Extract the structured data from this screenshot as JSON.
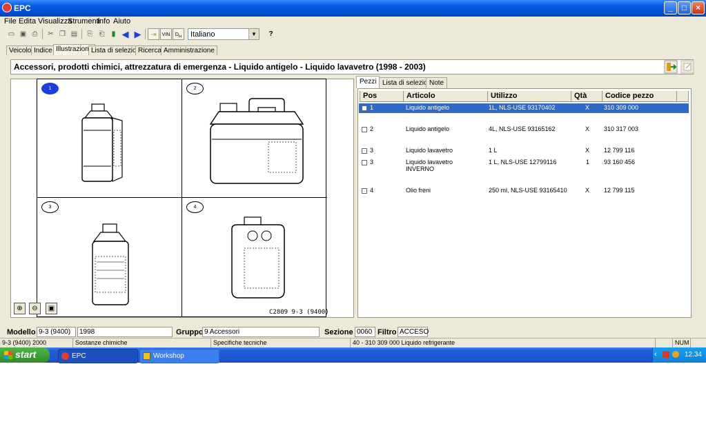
{
  "window": {
    "title": "EPC",
    "buttons": {
      "minimize": "_",
      "maximize": "□",
      "close": "×"
    }
  },
  "menu": [
    "File",
    "Edita",
    "Visualizza",
    "Strumenti",
    "Info",
    "Aiuto"
  ],
  "toolbar": {
    "language": "Italiano",
    "vin_label": "VIN",
    "help_label": "?"
  },
  "main_tabs": [
    "Veicolo",
    "Indice",
    "Illustrazione",
    "Lista di selezione",
    "Ricerca",
    "Amministrazione"
  ],
  "active_main_tab": "Illustrazione",
  "header": {
    "title": "Accessori, prodotti chimici, attrezzatura di emergenza - Liquido antigelo - Liquido lavavetro   (1998 - 2003)"
  },
  "illustration": {
    "cells": [
      "1",
      "2",
      "3",
      "4"
    ],
    "caption": "C2809 9-3 (9400)"
  },
  "parts_tabs": [
    "Pezzi",
    "Lista di selezione",
    "Note"
  ],
  "parts_table": {
    "columns": [
      "Pos",
      "Articolo",
      "Utilizzo",
      "Qtà",
      "Codice pezzo"
    ],
    "rows": [
      {
        "pos": "1",
        "articolo": "Liquido antigelo",
        "articolo2": "",
        "utilizzo": "1L, NLS-USE 93170402",
        "qta": "X",
        "codice": "310 309 000",
        "selected": true
      },
      {
        "pos": "2",
        "articolo": "Liquido antigelo",
        "articolo2": "",
        "utilizzo": "4L, NLS-USE 93165162",
        "qta": "X",
        "codice": "310 317 003",
        "selected": false
      },
      {
        "pos": "3",
        "articolo": "Liquido lavavetro",
        "articolo2": "",
        "utilizzo": "1 L",
        "qta": "X",
        "codice": "12 799 116",
        "selected": false
      },
      {
        "pos": "3",
        "articolo": "Liquido lavavetro",
        "articolo2": "INVERNO",
        "utilizzo": "1 L, NLS-USE 12799116",
        "qta": "1",
        "codice": "93 160 456",
        "selected": false
      },
      {
        "pos": "4",
        "articolo": "Olio freni",
        "articolo2": "",
        "utilizzo": "250 ml, NLS-USE 93165410",
        "qta": "X",
        "codice": "12 799 115",
        "selected": false
      }
    ]
  },
  "status_fields": {
    "modello_label": "Modello",
    "modello": "9-3 (9400)",
    "anno": "1998",
    "gruppo_label": "Gruppo",
    "gruppo": "9 Accessori",
    "sezione_label": "Sezione",
    "sezione": "0060",
    "filtro_label": "Filtro",
    "filtro": "ACCESO"
  },
  "statusbar": [
    "9-3 (9400) 2000",
    "Sostanze chimiche",
    "Specifiche tecniche",
    "40 - 310 309 000 Liquido refrigerante",
    "NUM"
  ],
  "taskbar": {
    "start": "start",
    "tasks": [
      "EPC",
      "Workshop Informatio..."
    ],
    "clock": "12.34"
  },
  "colors": {
    "titlebar": "#0052d8",
    "selection": "#316ac5",
    "selected_badge": "#1c3fe0"
  }
}
